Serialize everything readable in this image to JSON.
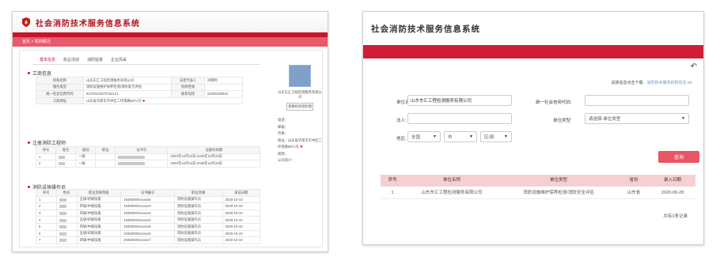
{
  "left": {
    "title": "社会消防技术服务信息系统",
    "breadcrumb": "首页 > 机构概况",
    "tabs": [
      "基本信息",
      "执业活动",
      "消防监督",
      "企业风采"
    ],
    "section_business": "工商信息",
    "business": {
      "name_label": "机构名称",
      "name_value": "山东东汇工程检测服务有限公司",
      "legal_label": "法定代表人",
      "legal_value": "刘晓明",
      "scope_label": "服务类型",
      "scope_value": "消防设施维护保养检测/消防安全评估",
      "nature_label": "机构性质",
      "nature_value": "",
      "credit_label": "统一社会信用代码",
      "credit_value": "91370103070752121",
      "phone_label": "联系电话",
      "phone_value": "15269188034",
      "addr_label": "工商地址",
      "addr_value": "山东省济南市市中区二环南路6871号"
    },
    "section_reg": "注册消防工程师",
    "reg_headers": [
      "序号",
      "姓名",
      "级别",
      "职位",
      "证书号",
      "注册有效期"
    ],
    "reg_rows": [
      {
        "no": "1",
        "level": "一级",
        "validity": "2020年10月23日-2025年10月23日"
      },
      {
        "no": "2",
        "level": "一级",
        "validity": "2020年10月23日-2025年10月23日"
      }
    ],
    "section_ops": "消防设施操作员",
    "ops_headers": [
      "序号",
      "姓名",
      "职业资格等级",
      "证书编号",
      "职业资格",
      "发证日期"
    ],
    "ops_rows": [
      {
        "no": "1",
        "grade": "五级/初级技能",
        "cert": "19360000xxxxxx6",
        "qual": "消防设施操作员",
        "date": "2020-10-10"
      },
      {
        "no": "2",
        "grade": "四级/中级技能",
        "cert": "19360000xxxxxx3",
        "qual": "消防设施操作员",
        "date": "2020-10-10"
      },
      {
        "no": "3",
        "grade": "四级/中级技能",
        "cert": "19360000xxxxxx4",
        "qual": "消防设施操作员",
        "date": "2020-10-10"
      },
      {
        "no": "4",
        "grade": "五级/初级技能",
        "cert": "19360000xxxxxx2",
        "qual": "消防设施操作员",
        "date": "2020-10-10"
      },
      {
        "no": "5",
        "grade": "四级/中级技能",
        "cert": "19360000xxxxxx5",
        "qual": "消防设施操作员",
        "date": "2020-10-10"
      },
      {
        "no": "6",
        "grade": "五级/初级技能",
        "cert": "20360000xxxxxx6",
        "qual": "消防设施操作员",
        "date": "2020-10-10"
      },
      {
        "no": "7",
        "grade": "四级/中级技能",
        "cert": "20360000xxxxxx7",
        "qual": "消防设施操作员",
        "date": "2020-10-10"
      }
    ],
    "side": {
      "company": "山东东汇工程检测服务有限公司",
      "button": "查看机构组织图",
      "f1": "电话：",
      "f2": "邮箱：",
      "f3": "传真：",
      "f4": "地址：山东省济南市市中区二环南路6871号",
      "f5": "简称：",
      "f6": "公司简介："
    }
  },
  "right": {
    "title": "社会消防技术服务信息系统",
    "download": "具体信息点击下载：",
    "download_link": "消防技术服务机构信息.xls",
    "unit_name_label": "单位名称:",
    "unit_name_value": "山东东汇工程检测服务有限公司",
    "credit_label": "统一社会信用代码:",
    "credit_value": "",
    "legal_label": "法人:",
    "legal_value": "",
    "unit_type_label": "单位类型:",
    "unit_type_value": "请选择-单位类型",
    "region_label": "地区:",
    "region_province": "全国",
    "region_city": "市",
    "region_district": "区/县",
    "search": "查询",
    "headers": [
      "序号",
      "单位名称",
      "单位类型",
      "省份",
      "录入日期"
    ],
    "row": {
      "no": "1",
      "name": "山东东汇工程检测服务有限公司",
      "type": "消防设施维护保养检测/消防安全评估",
      "province": "山东省",
      "date": "2020-09-28"
    },
    "total_prefix": "共有",
    "total_count": "1",
    "total_suffix": "条记录"
  }
}
